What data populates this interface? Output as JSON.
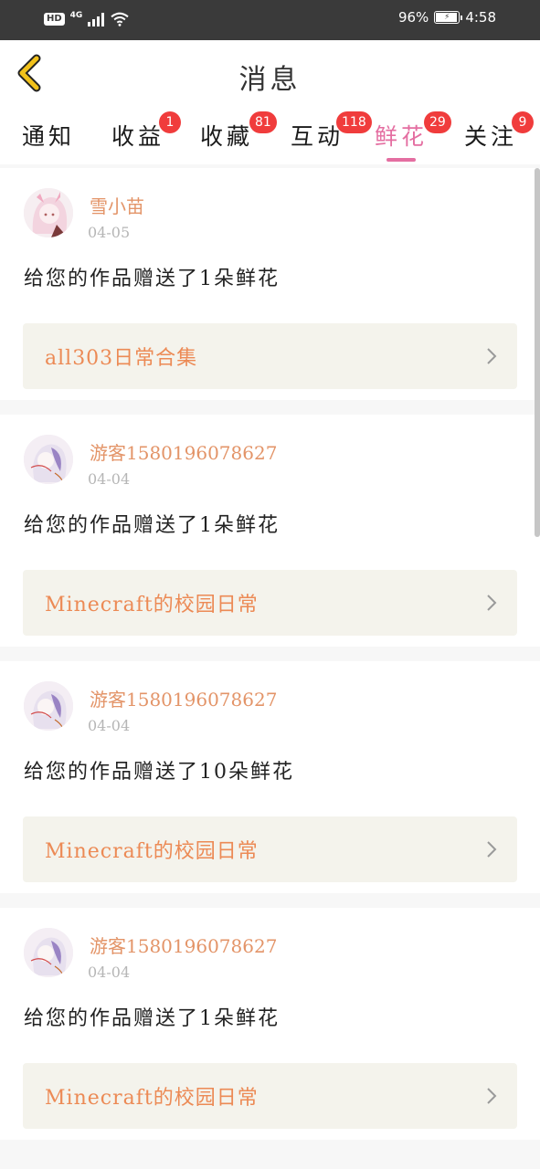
{
  "status_bar": {
    "hd": "HD",
    "network": "4G",
    "battery_percent": "96%",
    "battery_level": 0.96,
    "time": "4:58"
  },
  "header": {
    "title": "消息",
    "back_icon": "chevron-left-icon",
    "accent_color": "#f2c21b"
  },
  "tabs": [
    {
      "label": "通知",
      "badge": null
    },
    {
      "label": "收益",
      "badge": "1"
    },
    {
      "label": "收藏",
      "badge": "81"
    },
    {
      "label": "互动",
      "badge": "118"
    },
    {
      "label": "鲜花",
      "badge": "29",
      "active": true
    },
    {
      "label": "关注",
      "badge": "9"
    }
  ],
  "colors": {
    "active_tab": "#e46ea1",
    "badge": "#f03c3c",
    "username": "#e39468",
    "work_title": "#ec8a55",
    "work_bg": "#f4f3ec"
  },
  "messages": [
    {
      "username": "雪小苗",
      "date": "04-05",
      "text": "给您的作品赠送了1朵鲜花",
      "work_title": "all303日常合集"
    },
    {
      "username": "游客1580196078627",
      "date": "04-04",
      "text": "给您的作品赠送了1朵鲜花",
      "work_title": "Minecraft的校园日常"
    },
    {
      "username": "游客1580196078627",
      "date": "04-04",
      "text": "给您的作品赠送了10朵鲜花",
      "work_title": "Minecraft的校园日常"
    },
    {
      "username": "游客1580196078627",
      "date": "04-04",
      "text": "给您的作品赠送了1朵鲜花",
      "work_title": "Minecraft的校园日常"
    }
  ]
}
